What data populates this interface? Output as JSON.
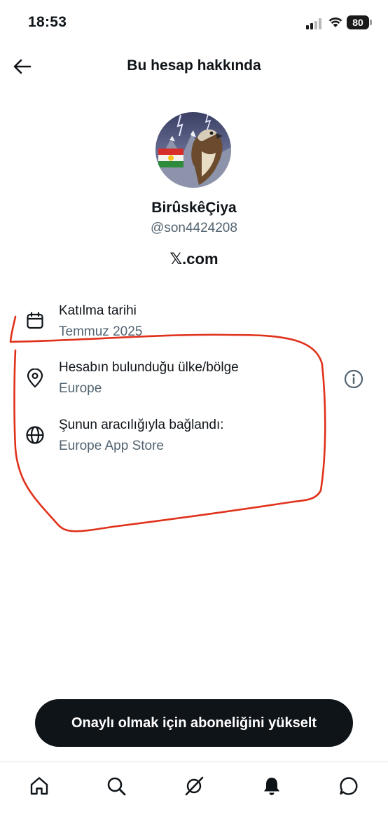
{
  "status_bar": {
    "time": "18:53",
    "battery": "80"
  },
  "header": {
    "title": "Bu hesap hakkında",
    "back_icon": "arrow-left-icon"
  },
  "profile": {
    "display_name": "BirûskêÇiya",
    "handle": "@son4424208",
    "site": "𝕏.com"
  },
  "info_rows": [
    {
      "icon": "calendar-icon",
      "label": "Katılma tarihi",
      "value": "Temmuz 2025"
    },
    {
      "icon": "location-pin-icon",
      "label": "Hesabın bulunduğu ülke/bölge",
      "value": "Europe"
    },
    {
      "icon": "globe-icon",
      "label": "Şunun aracılığıyla bağlandı:",
      "value": "Europe App Store"
    }
  ],
  "upgrade_button": {
    "label": "Onaylı olmak için aboneliğini yükselt"
  },
  "tab_bar": [
    "home-icon",
    "search-icon",
    "grok-icon",
    "notifications-icon",
    "messages-icon"
  ],
  "colors": {
    "text": "#0f1419",
    "secondary": "#536471",
    "annotation": "#e0311b",
    "button": "#0f1419"
  }
}
